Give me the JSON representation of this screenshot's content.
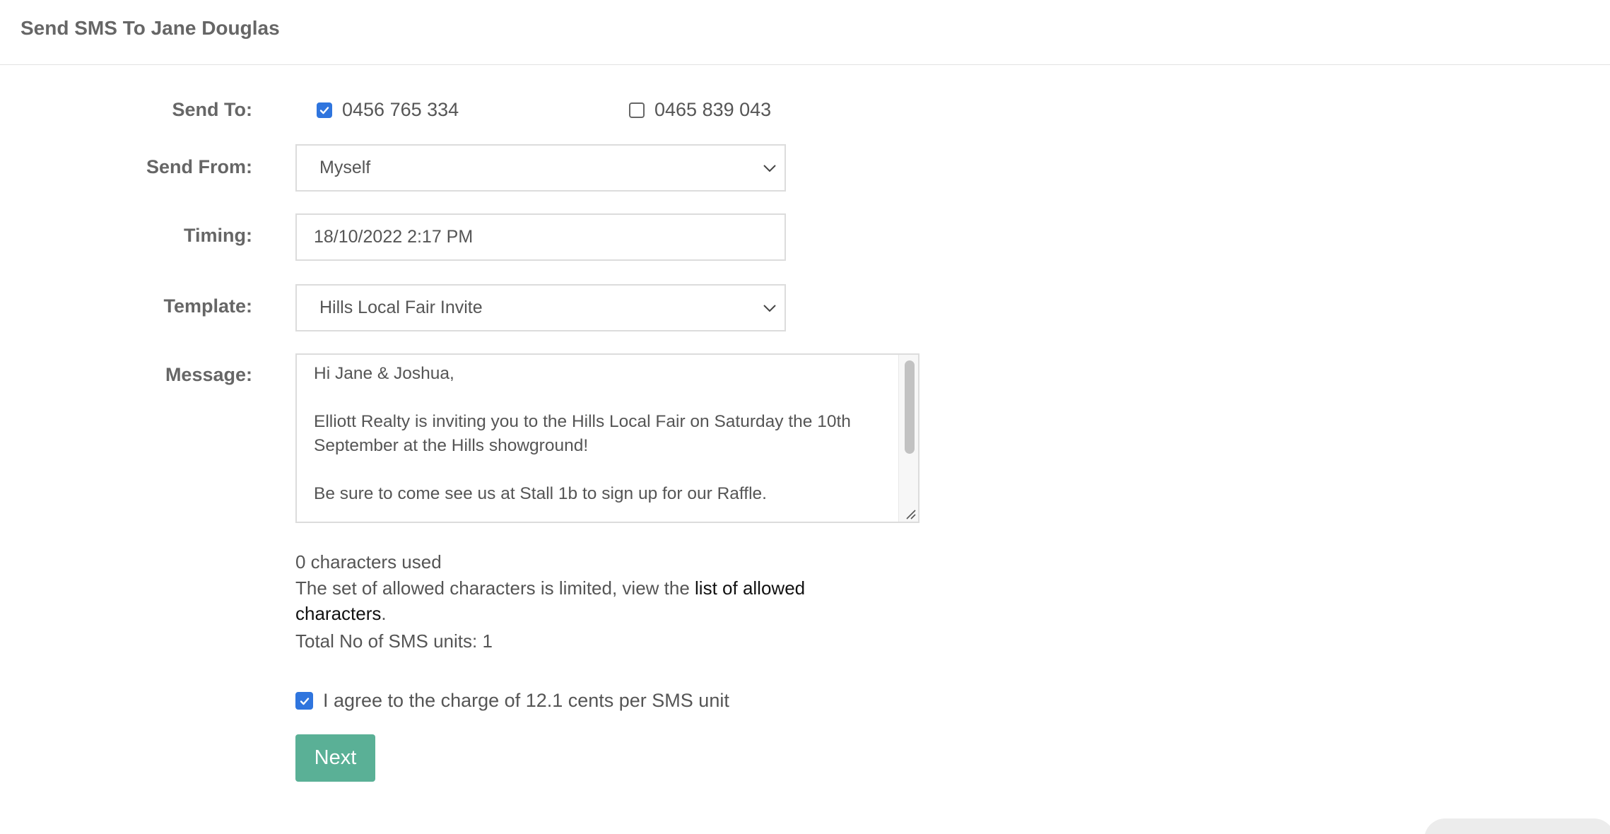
{
  "header": {
    "title": "Send SMS To Jane Douglas"
  },
  "form": {
    "send_to": {
      "label": "Send To:",
      "options": [
        {
          "number": "0456 765 334",
          "checked": true
        },
        {
          "number": "0465 839 043",
          "checked": false
        }
      ]
    },
    "send_from": {
      "label": "Send From:",
      "value": "Myself"
    },
    "timing": {
      "label": "Timing:",
      "value": "18/10/2022 2:17 PM"
    },
    "template": {
      "label": "Template:",
      "value": "Hills Local Fair Invite"
    },
    "message": {
      "label": "Message:",
      "lines": [
        "Hi Jane & Joshua,",
        "",
        "Elliott Realty is inviting you to the Hills Local Fair on Saturday the 10th",
        "September at the Hills showground!",
        "",
        "Be sure to come see us at Stall 1b to sign up for our Raffle."
      ]
    },
    "info": {
      "characters_used": "0 characters used",
      "allowed_prefix": "The set of allowed characters is limited, view the ",
      "allowed_link_line1": "list of allowed",
      "allowed_link_line2": "characters",
      "allowed_suffix": ".",
      "units": "Total No of SMS units: 1"
    },
    "agree": {
      "label": "I agree to the charge of 12.1 cents per SMS unit",
      "checked": true
    },
    "next_label": "Next"
  },
  "colors": {
    "accent": "#2f75de",
    "button": "#5ab096"
  },
  "icons": {
    "checkbox_checked": "check-icon",
    "dropdown": "chevron-down-icon",
    "resize": "resize-grip-icon"
  }
}
